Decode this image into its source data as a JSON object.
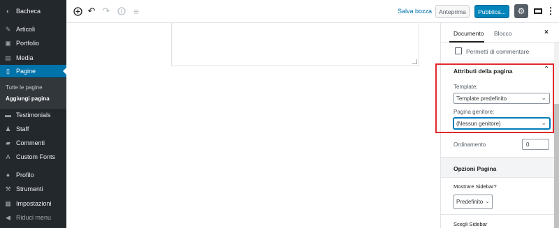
{
  "admin_menu": {
    "items": [
      {
        "label": "Bacheca",
        "icon": "dashboard-icon"
      },
      {
        "label": "Articoli",
        "icon": "pin-icon"
      },
      {
        "label": "Portfolio",
        "icon": "portfolio-icon"
      },
      {
        "label": "Media",
        "icon": "media-icon"
      },
      {
        "label": "Pagine",
        "icon": "pages-icon",
        "active": true
      },
      {
        "label": "Testimonials",
        "icon": "testimonials-icon"
      },
      {
        "label": "Staff",
        "icon": "staff-icon"
      },
      {
        "label": "Commenti",
        "icon": "comments-icon"
      },
      {
        "label": "Custom Fonts",
        "icon": "font-icon"
      },
      {
        "label": "Profilo",
        "icon": "user-icon"
      },
      {
        "label": "Strumenti",
        "icon": "wrench-icon"
      },
      {
        "label": "Impostazioni",
        "icon": "settings-icon"
      },
      {
        "label": "Riduci menu",
        "icon": "collapse-icon"
      }
    ],
    "submenu": [
      "Tutte le pagine",
      "Aggiungi pagina"
    ]
  },
  "toolbar": {
    "save_draft": "Salva bozza",
    "preview": "Anteprima",
    "publish": "Pubblica..."
  },
  "sidebar": {
    "tab_document": "Documento",
    "tab_block": "Blocco",
    "close": "×",
    "comments_label": "Permetti di commentare",
    "page_attributes_title": "Attributi della pagina",
    "template_label": "Template:",
    "template_value": "Template predefinito",
    "parent_label": "Pagina genitore:",
    "parent_value": "(Nessun genitore)",
    "order_label": "Ordinamento",
    "order_value": "0",
    "options_title": "Opzioni Pagina",
    "show_sidebar_label": "Mostrare Sidebar?",
    "show_sidebar_value": "Predefinito",
    "choose_sidebar_label": "Scegli Sidebar"
  },
  "colors": {
    "admin_bg": "#23282d",
    "active": "#0073aa",
    "publish": "#0085ba",
    "highlight": "#e0282b"
  }
}
